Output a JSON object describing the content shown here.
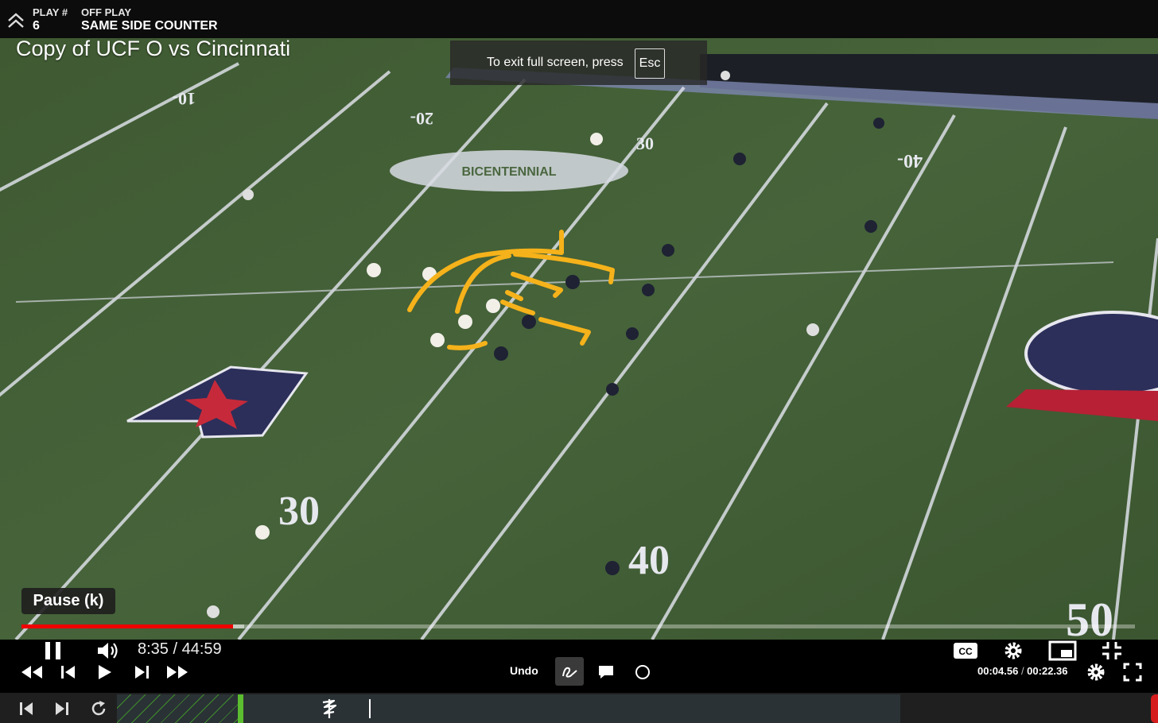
{
  "play": {
    "number_label": "PLAY #",
    "number": "6",
    "type_label": "OFF PLAY",
    "name": "SAME SIDE COUNTER"
  },
  "video": {
    "title": "Copy of UCF O vs Cincinnati"
  },
  "fullscreen_toast": {
    "text": "To exit full screen, press",
    "key": "Esc"
  },
  "tooltip": {
    "text": "Pause (k)"
  },
  "player": {
    "current_time": "8:35",
    "duration": "44:59",
    "separator": "/",
    "progress": 0.19
  },
  "field": {
    "yard_numbers": [
      "10",
      "20",
      "30",
      "40",
      "30",
      "40",
      "50"
    ],
    "logo_text": "BICENTENNIAL"
  },
  "telestration": {
    "color": "#f5b21a"
  },
  "tools": {
    "undo_label": "Undo"
  },
  "clip": {
    "elapsed": "00:04.56",
    "total": "00:22.36",
    "separator": " / "
  },
  "colors": {
    "progress": "#e00000",
    "timeline_marker": "#5bbd2f",
    "accent_red": "#d61d1d"
  },
  "icons": [
    "chevron-up-icon",
    "pause-icon",
    "volume-icon",
    "captions-icon",
    "settings-icon",
    "miniplayer-icon",
    "exit-fullscreen-icon",
    "rewind-icon",
    "step-back-icon",
    "play-icon",
    "step-forward-icon",
    "fast-forward-icon",
    "draw-icon",
    "comment-icon",
    "circle-icon",
    "gear-icon",
    "fullscreen-icon",
    "skip-start-icon",
    "skip-end-icon",
    "refresh-icon",
    "scribble-icon"
  ]
}
